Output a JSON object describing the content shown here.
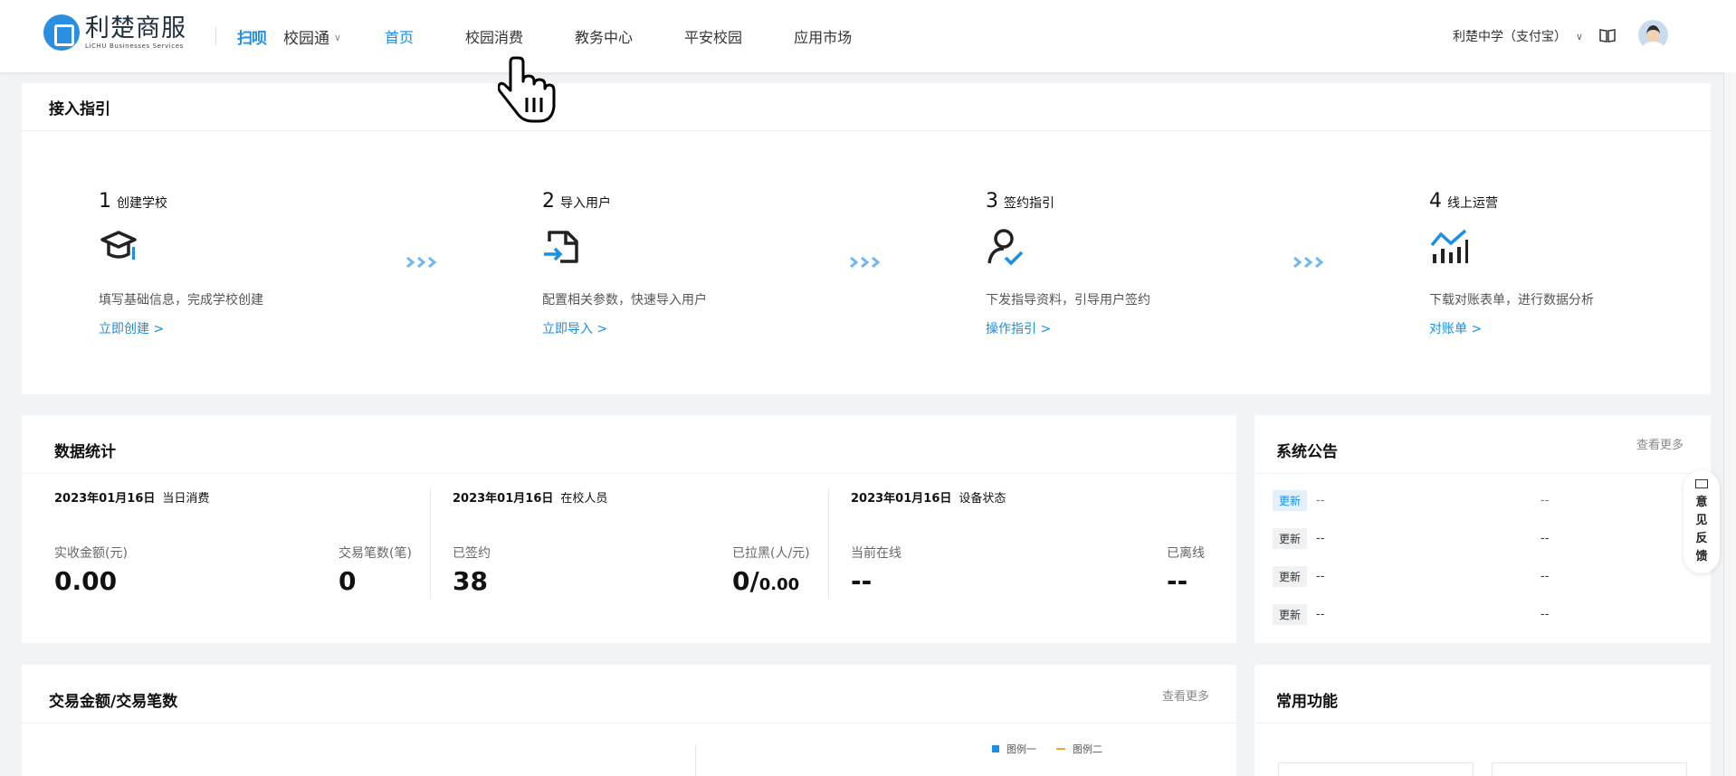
{
  "header": {
    "logo_cn": "利楚商服",
    "logo_en": "LiCHU Businesses Services",
    "scan_brand": "扫呗",
    "product": "校园通",
    "nav": [
      {
        "label": "首页",
        "active": true
      },
      {
        "label": "校园消费",
        "active": false
      },
      {
        "label": "教务中心",
        "active": false
      },
      {
        "label": "平安校园",
        "active": false
      },
      {
        "label": "应用市场",
        "active": false
      }
    ],
    "school": "利楚中学（支付宝）"
  },
  "guide": {
    "title": "接入指引",
    "steps": [
      {
        "num": "1",
        "title": "创建学校",
        "icon": "graduation-cap-icon",
        "desc": "填写基础信息，完成学校创建",
        "link": "立即创建 >"
      },
      {
        "num": "2",
        "title": "导入用户",
        "icon": "import-file-icon",
        "desc": "配置相关参数，快速导入用户",
        "link": "立即导入 >"
      },
      {
        "num": "3",
        "title": "签约指引",
        "icon": "user-check-icon",
        "desc": "下发指导资料，引导用户签约",
        "link": "操作指引 >"
      },
      {
        "num": "4",
        "title": "线上运营",
        "icon": "analytics-icon",
        "desc": "下载对账表单，进行数据分析",
        "link": "对账单 >"
      }
    ]
  },
  "stats": {
    "title": "数据统计",
    "columns": [
      {
        "date": "2023年01月16日",
        "label": "当日消费",
        "left_label": "实收金额(元)",
        "left_value": "0.00",
        "right_label": "交易笔数(笔)",
        "right_value": "0",
        "right_suffix": ""
      },
      {
        "date": "2023年01月16日",
        "label": "在校人员",
        "left_label": "已签约",
        "left_value": "38",
        "right_label": "已拉黑(人/元)",
        "right_value": "0/",
        "right_suffix": "0.00"
      },
      {
        "date": "2023年01月16日",
        "label": "设备状态",
        "left_label": "当前在线",
        "left_value": "--",
        "right_label": "已离线",
        "right_value": "--",
        "right_suffix": ""
      }
    ]
  },
  "notices": {
    "title": "系统公告",
    "more": "查看更多",
    "rows": [
      {
        "badge": "更新",
        "text": "--",
        "right": "--",
        "highlight": true
      },
      {
        "badge": "更新",
        "text": "--",
        "right": "--",
        "highlight": false
      },
      {
        "badge": "更新",
        "text": "--",
        "right": "--",
        "highlight": false
      },
      {
        "badge": "更新",
        "text": "--",
        "right": "--",
        "highlight": false
      }
    ]
  },
  "feedback": {
    "label": "意见反馈"
  },
  "trade": {
    "title": "交易金额/交易笔数",
    "more": "查看更多",
    "legend": [
      {
        "label": "图例一",
        "color": "#1b8fe5"
      },
      {
        "label": "图例二",
        "color": "#f5a623"
      }
    ]
  },
  "common": {
    "title": "常用功能"
  },
  "colors": {
    "accent": "#1b8fe5",
    "secondary": "#f5a623"
  }
}
